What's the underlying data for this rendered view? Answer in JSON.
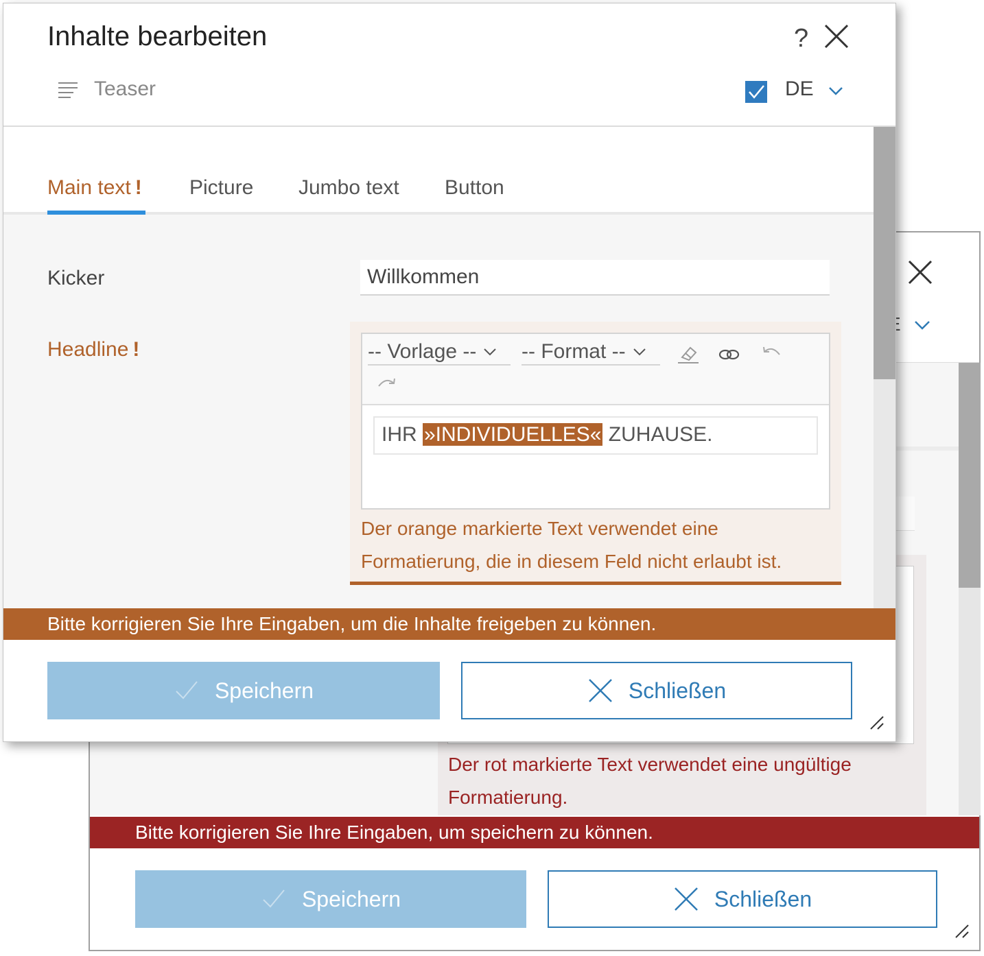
{
  "dialog": {
    "title": "Inhalte bearbeiten",
    "help_icon": "?",
    "content_type": "Teaser",
    "language": "DE",
    "language_checked": true,
    "tabs": [
      {
        "label": "Main text",
        "flag": "!",
        "active": true
      },
      {
        "label": "Picture"
      },
      {
        "label": "Jumbo text"
      },
      {
        "label": "Button"
      }
    ],
    "fields": {
      "kicker": {
        "label": "Kicker",
        "value": "Willkommen"
      },
      "headline": {
        "label": "Headline",
        "flag": "!",
        "toolbar": {
          "template_select": "-- Vorlage --",
          "format_select": "-- Format --",
          "icons": [
            "eraser-icon",
            "link-icon",
            "undo-icon",
            "redo-icon"
          ]
        },
        "text_before": "IHR ",
        "text_highlight": "»INDIVIDUELLES«",
        "text_after": " ZUHAUSE.",
        "hint": "Der orange markierte Text verwendet eine Formatierung, die in diesem Feld nicht erlaubt ist."
      }
    },
    "error_message": "Bitte korrigieren Sie Ihre Eingaben, um die Inhalte freigeben zu können.",
    "save_label": "Speichern",
    "close_label": "Schließen"
  },
  "back_dialog": {
    "partial_lang": "E",
    "hint": "Der rot markierte Text verwendet eine ungültige Formatierung.",
    "error_message": "Bitte korrigieren Sie Ihre Eingaben, um speichern zu können.",
    "save_label": "Speichern",
    "close_label": "Schließen"
  },
  "colors": {
    "warning_orange": "#b0622b",
    "error_red": "#9b2424",
    "accent_blue": "#2f7bb5",
    "disabled_blue": "#97c2e0",
    "tab_underline": "#2f8fdc"
  }
}
